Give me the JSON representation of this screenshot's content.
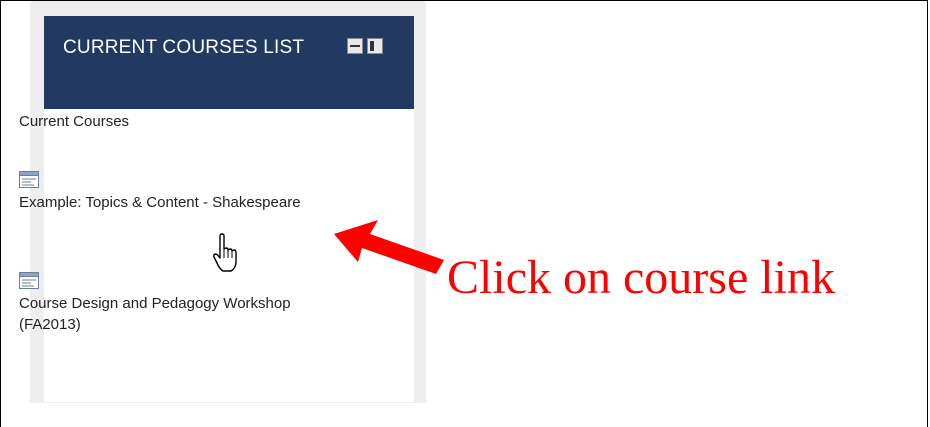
{
  "block": {
    "title": "CURRENT COURSES LIST",
    "minimize_icon": "minimize-icon",
    "dock_icon": "dock-icon",
    "header_color": "#223a62"
  },
  "section_label": "Current Courses",
  "courses": [
    {
      "icon": "course-icon",
      "label": "Example: Topics & Content - Shakespeare"
    },
    {
      "icon": "course-icon",
      "label": "Course Design and Pedagogy Workshop (FA2013)"
    }
  ],
  "annotation": {
    "text": "Click on course link",
    "color": "#ff0000",
    "arrow_icon": "red-arrow-icon",
    "cursor_icon": "hand-cursor-icon"
  }
}
